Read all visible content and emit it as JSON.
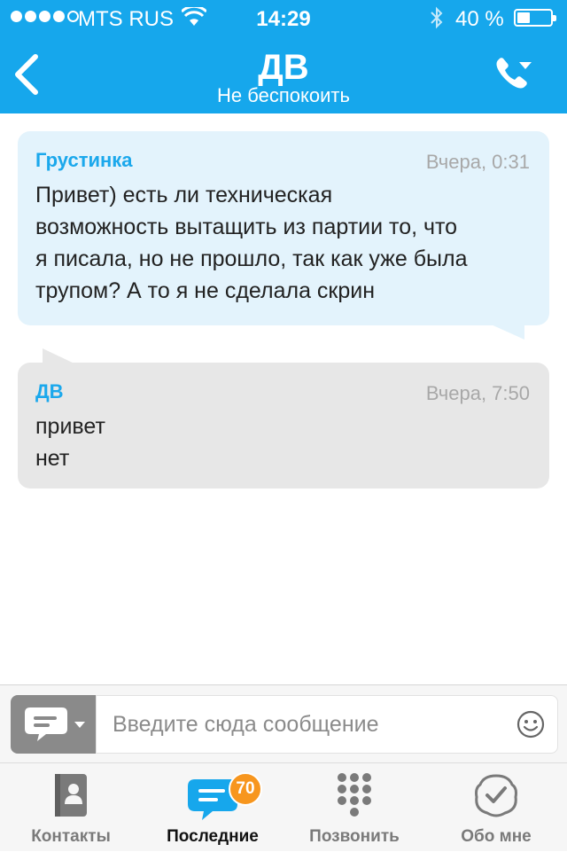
{
  "status_bar": {
    "carrier": "MTS RUS",
    "time": "14:29",
    "battery_text": "40 %",
    "battery_level": 0.4,
    "signal_bars": 4,
    "signal_max": 5
  },
  "header": {
    "title": "ДВ",
    "subtitle": "Не беспокоить",
    "background": "#16a7ec"
  },
  "messages": [
    {
      "author": "Грустинка",
      "time": "Вчера, 0:31",
      "text": "Привет) есть ли техническая\nвозможность вытащить из партии то, что\nя писала, но не прошло, так как уже была\nтрупом? А то я не сделала скрин"
    },
    {
      "author": "ДВ",
      "time": "Вчера, 7:50",
      "text": "привет\nнет"
    }
  ],
  "composer": {
    "placeholder": "Введите сюда сообщение",
    "value": ""
  },
  "tabs": [
    {
      "label": "Контакты",
      "icon": "contacts-icon",
      "active": false
    },
    {
      "label": "Последние",
      "icon": "recent-chat-icon",
      "active": true,
      "badge": "70"
    },
    {
      "label": "Позвонить",
      "icon": "dialpad-icon",
      "active": false
    },
    {
      "label": "Обо мне",
      "icon": "profile-check-icon",
      "active": false
    }
  ],
  "colors": {
    "accent": "#16a7ec",
    "incoming_bubble": "#e3f3fc",
    "outgoing_bubble": "#e7e7e7",
    "badge": "#f7961e"
  }
}
